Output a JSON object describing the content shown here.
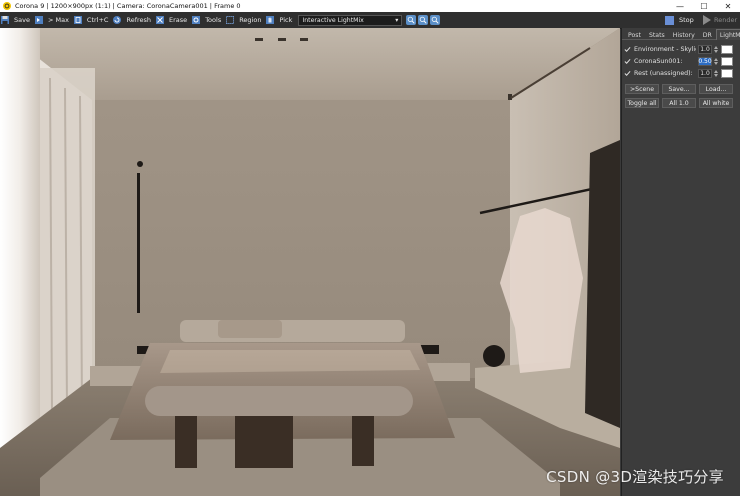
{
  "window": {
    "title": "Corona 9 | 1200×900px (1:1) | Camera: CoronaCamera001 | Frame 0",
    "controls": {
      "minimize": "—",
      "maximize": "☐",
      "close": "✕"
    }
  },
  "toolbar": {
    "save": "Save",
    "max": "> Max",
    "copy": "Ctrl+C",
    "refresh": "Refresh",
    "erase": "Erase",
    "tools": "Tools",
    "region": "Region",
    "pick": "Pick",
    "lightmix_select": "Interactive LightMix",
    "stop": "Stop",
    "render": "Render"
  },
  "panel": {
    "tabs": [
      "Post",
      "Stats",
      "History",
      "DR",
      "LightMix"
    ],
    "active_tab": "LightMix",
    "lights": [
      {
        "name": "Environment - Skylight",
        "value": "1.0",
        "checked": true,
        "selected": false,
        "color": "#ffffff"
      },
      {
        "name": "CoronaSun001:",
        "value": "0.50",
        "checked": true,
        "selected": true,
        "color": "#ffffff"
      },
      {
        "name": "Rest (unassigned):",
        "value": "1.0",
        "checked": true,
        "selected": false,
        "color": "#ffffff"
      }
    ],
    "buttons_row1": [
      ">Scene",
      "Save...",
      "Load..."
    ],
    "buttons_row2": [
      "Toggle all",
      "All 1.0",
      "All white"
    ]
  },
  "watermark": "CSDN @3D渲染技巧分享",
  "colors": {
    "accent": "#2b6cc4",
    "panel_bg": "#3c3c3c",
    "toolbar_bg": "#2f2f2f"
  }
}
